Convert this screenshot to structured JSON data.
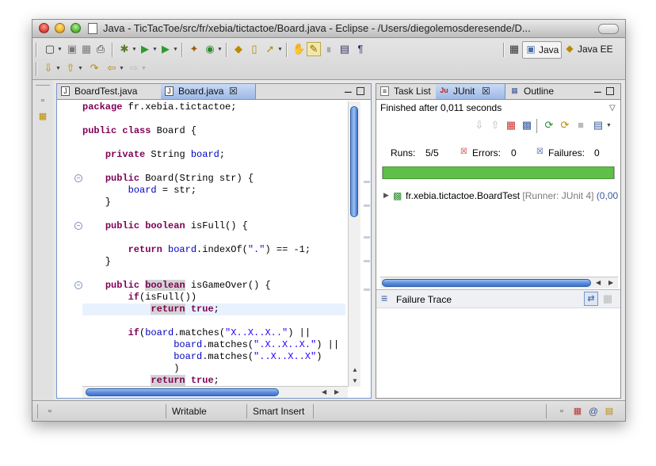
{
  "window": {
    "title": "Java - TicTacToe/src/fr/xebia/tictactoe/Board.java - Eclipse - /Users/diegolemosderesende/D..."
  },
  "toolbar": {
    "icons": [
      "new-icon",
      "save-icon",
      "save-all-icon",
      "print-icon",
      "debug-icon",
      "run-icon",
      "external-tools-icon",
      "new-java-project-icon",
      "new-java-class-icon",
      "open-type-icon",
      "open-task-icon",
      "search-icon",
      "toggle-mark-occurrences-icon",
      "highlight-icon",
      "show-whitespace-icon",
      "show-source-icon",
      "next-annotation-icon",
      "previous-annotation-icon",
      "last-edit-icon",
      "back-icon",
      "forward-icon"
    ],
    "perspectives": [
      {
        "label": "Java",
        "active": true
      },
      {
        "label": "Java EE",
        "active": false
      }
    ]
  },
  "editor": {
    "tabs": [
      {
        "label": "BoardTest.java",
        "active": false
      },
      {
        "label": "Board.java",
        "active": true
      }
    ],
    "code_lines": [
      [
        {
          "t": "package",
          "k": "kw"
        },
        {
          "t": " fr.xebia.tictactoe;",
          "k": ""
        }
      ],
      [],
      [
        {
          "t": "public",
          "k": "kw"
        },
        {
          "t": " ",
          "k": ""
        },
        {
          "t": "class",
          "k": "kw"
        },
        {
          "t": " Board {",
          "k": ""
        }
      ],
      [],
      [
        {
          "t": "    ",
          "k": ""
        },
        {
          "t": "private",
          "k": "kw"
        },
        {
          "t": " String ",
          "k": ""
        },
        {
          "t": "board",
          "k": "fld"
        },
        {
          "t": ";",
          "k": ""
        }
      ],
      [],
      [
        {
          "t": "    ",
          "k": ""
        },
        {
          "t": "public",
          "k": "kw"
        },
        {
          "t": " Board(String str) {",
          "k": ""
        }
      ],
      [
        {
          "t": "        ",
          "k": ""
        },
        {
          "t": "board",
          "k": "fld"
        },
        {
          "t": " = str;",
          "k": ""
        }
      ],
      [
        {
          "t": "    }",
          "k": ""
        }
      ],
      [],
      [
        {
          "t": "    ",
          "k": ""
        },
        {
          "t": "public",
          "k": "kw"
        },
        {
          "t": " ",
          "k": ""
        },
        {
          "t": "boolean",
          "k": "kw"
        },
        {
          "t": " isFull() {",
          "k": ""
        }
      ],
      [],
      [
        {
          "t": "        ",
          "k": ""
        },
        {
          "t": "return",
          "k": "kw"
        },
        {
          "t": " ",
          "k": ""
        },
        {
          "t": "board",
          "k": "fld"
        },
        {
          "t": ".indexOf(",
          "k": ""
        },
        {
          "t": "\".\"",
          "k": "str"
        },
        {
          "t": ") == -1;",
          "k": ""
        }
      ],
      [
        {
          "t": "    }",
          "k": ""
        }
      ],
      [],
      [
        {
          "t": "    ",
          "k": ""
        },
        {
          "t": "public",
          "k": "kw"
        },
        {
          "t": " ",
          "k": ""
        },
        {
          "t": "boolean",
          "k": "kw",
          "hl": true
        },
        {
          "t": " isGameOver() {",
          "k": ""
        }
      ],
      [
        {
          "t": "        ",
          "k": ""
        },
        {
          "t": "if",
          "k": "kw"
        },
        {
          "t": "(isFull())",
          "k": ""
        }
      ],
      [
        {
          "t": "            ",
          "k": ""
        },
        {
          "t": "return",
          "k": "kw",
          "hl": true
        },
        {
          "t": " ",
          "k": ""
        },
        {
          "t": "true",
          "k": "kw"
        },
        {
          "t": ";",
          "k": ""
        }
      ],
      [],
      [
        {
          "t": "        ",
          "k": ""
        },
        {
          "t": "if",
          "k": "kw"
        },
        {
          "t": "(",
          "k": ""
        },
        {
          "t": "board",
          "k": "fld"
        },
        {
          "t": ".matches(",
          "k": ""
        },
        {
          "t": "\"X..X..X..\"",
          "k": "str"
        },
        {
          "t": ") ||",
          "k": ""
        }
      ],
      [
        {
          "t": "                ",
          "k": ""
        },
        {
          "t": "board",
          "k": "fld"
        },
        {
          "t": ".matches(",
          "k": ""
        },
        {
          "t": "\".X..X..X.\"",
          "k": "str"
        },
        {
          "t": ") ||",
          "k": ""
        }
      ],
      [
        {
          "t": "                ",
          "k": ""
        },
        {
          "t": "board",
          "k": "fld"
        },
        {
          "t": ".matches(",
          "k": ""
        },
        {
          "t": "\"..X..X..X\"",
          "k": "str"
        },
        {
          "t": ")",
          "k": ""
        }
      ],
      [
        {
          "t": "                )",
          "k": ""
        }
      ],
      [
        {
          "t": "            ",
          "k": ""
        },
        {
          "t": "return",
          "k": "kw",
          "hl": true
        },
        {
          "t": " ",
          "k": ""
        },
        {
          "t": "true",
          "k": "kw"
        },
        {
          "t": ";",
          "k": ""
        }
      ]
    ],
    "current_line_index": 17,
    "folds_at_lines": [
      6,
      10,
      15
    ]
  },
  "right_panel": {
    "tabs": [
      {
        "label": "Task List",
        "active": false
      },
      {
        "label": "JUnit",
        "active": true
      },
      {
        "label": "Outline",
        "active": false
      }
    ],
    "junit": {
      "status": "Finished after 0,011 seconds",
      "runs_label": "Runs:",
      "runs_value": "5/5",
      "errors_label": "Errors:",
      "errors_value": "0",
      "failures_label": "Failures:",
      "failures_value": "0",
      "progress": 1.0,
      "progress_color": "#5fbf49",
      "tree_item": "fr.xebia.tictactoe.BoardTest",
      "tree_item_runner": "[Runner: JUnit 4]",
      "tree_item_time": "(0,00",
      "failure_trace_label": "Failure Trace"
    }
  },
  "statusbar": {
    "writable": "Writable",
    "insert_mode": "Smart Insert"
  },
  "colors": {
    "keyword": "#7f0055",
    "field": "#0000c0",
    "string": "#2a00ff",
    "active_tab": "#9db9e6",
    "current_line": "#e8f2fe",
    "occurrence_highlight": "#d4d4d4"
  }
}
